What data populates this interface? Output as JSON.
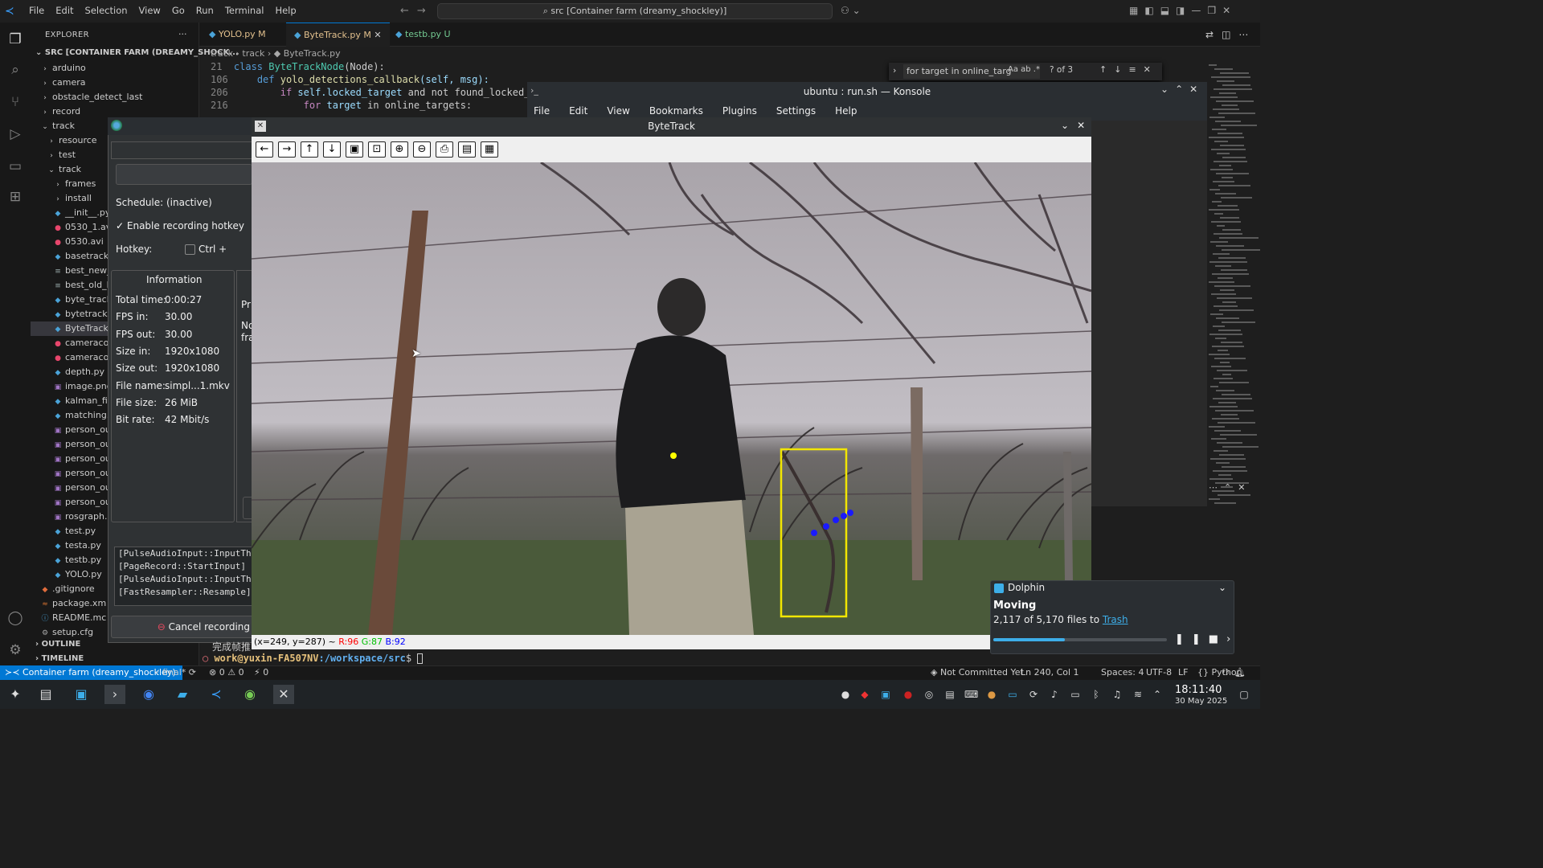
{
  "colors": {
    "accent": "#0078d4",
    "modified": "#e2c08d",
    "trash_link": "#3daee9",
    "tracking_box": "#f2e600",
    "track_points": "#1a1aff",
    "center_point": "#ffff00",
    "status_r": "#ff0000",
    "status_g": "#00c000",
    "status_b": "#0000ff"
  },
  "vscode": {
    "menu": [
      "File",
      "Edit",
      "Selection",
      "View",
      "Go",
      "Run",
      "Terminal",
      "Help"
    ],
    "command_center": "src [Container farm (dreamy_shockley)]",
    "explorer": {
      "title": "EXPLORER",
      "root": "SRC [CONTAINER FARM (DREAMY_SHOCK...",
      "items": [
        {
          "label": "arduino",
          "icon": "chevron-right-icon",
          "fic": "›"
        },
        {
          "label": "camera",
          "icon": "chevron-right-icon",
          "fic": "›"
        },
        {
          "label": "obstacle_detect_last",
          "icon": "chevron-right-icon",
          "fic": "›"
        },
        {
          "label": "record",
          "icon": "chevron-right-icon",
          "fic": "›"
        },
        {
          "label": "track",
          "icon": "chevron-down-icon",
          "fic": "⌄"
        },
        {
          "label": "resource",
          "icon": "chevron-right-icon",
          "fic": "›"
        },
        {
          "label": "test",
          "icon": "chevron-right-icon",
          "fic": "›"
        },
        {
          "label": "track",
          "icon": "chevron-down-icon",
          "fic": "⌄"
        },
        {
          "label": "frames",
          "icon": "chevron-right-icon",
          "fic": "›"
        },
        {
          "label": "install",
          "icon": "chevron-right-icon",
          "fic": "›"
        },
        {
          "label": "__init__.py",
          "icon": "python-file-icon",
          "fic": "◆"
        },
        {
          "label": "0530_1.avi",
          "icon": "video-file-icon",
          "fic": "●"
        },
        {
          "label": "0530.avi",
          "icon": "video-file-icon",
          "fic": "●"
        },
        {
          "label": "basetrack.",
          "icon": "python-file-icon",
          "fic": "◆"
        },
        {
          "label": "best_new_",
          "icon": "text-file-icon",
          "fic": "≡"
        },
        {
          "label": "best_old_l",
          "icon": "text-file-icon",
          "fic": "≡"
        },
        {
          "label": "byte_track",
          "icon": "python-file-icon",
          "fic": "◆"
        },
        {
          "label": "bytetrack.p",
          "icon": "python-file-icon",
          "fic": "◆"
        },
        {
          "label": "ByteTrack.",
          "icon": "python-file-icon",
          "fic": "◆"
        },
        {
          "label": "cameracol",
          "icon": "video-file-icon",
          "fic": "●"
        },
        {
          "label": "cameracol",
          "icon": "video-file-icon",
          "fic": "●"
        },
        {
          "label": "depth.py",
          "icon": "python-file-icon",
          "fic": "◆"
        },
        {
          "label": "image.png",
          "icon": "image-file-icon",
          "fic": "▣"
        },
        {
          "label": "kalman_filt",
          "icon": "python-file-icon",
          "fic": "◆"
        },
        {
          "label": "matching.p",
          "icon": "python-file-icon",
          "fic": "◆"
        },
        {
          "label": "person_ou",
          "icon": "image-file-icon",
          "fic": "▣"
        },
        {
          "label": "person_ou",
          "icon": "image-file-icon",
          "fic": "▣"
        },
        {
          "label": "person_ou",
          "icon": "image-file-icon",
          "fic": "▣"
        },
        {
          "label": "person_ou",
          "icon": "image-file-icon",
          "fic": "▣"
        },
        {
          "label": "person_ou",
          "icon": "image-file-icon",
          "fic": "▣"
        },
        {
          "label": "person_ou",
          "icon": "image-file-icon",
          "fic": "▣"
        },
        {
          "label": "rosgraph.p",
          "icon": "image-file-icon",
          "fic": "▣"
        },
        {
          "label": "test.py",
          "icon": "python-file-icon",
          "fic": "◆"
        },
        {
          "label": "testa.py",
          "icon": "python-file-icon",
          "fic": "◆"
        },
        {
          "label": "testb.py",
          "icon": "python-file-icon",
          "fic": "◆"
        },
        {
          "label": "YOLO.py",
          "icon": "python-file-icon",
          "fic": "◆"
        },
        {
          "label": ".gitignore",
          "icon": "git-icon",
          "fic": "◆"
        },
        {
          "label": "package.xm",
          "icon": "xml-file-icon",
          "fic": "≈"
        },
        {
          "label": "README.mc",
          "icon": "info-icon",
          "fic": "ⓘ"
        },
        {
          "label": "setup.cfg",
          "icon": "gear-icon",
          "fic": "⚙"
        }
      ],
      "outline": "OUTLINE",
      "timeline": "TIMELINE"
    },
    "tabs": [
      {
        "label": "YOLO.py  M"
      },
      {
        "label": "ByteTrack.py  M"
      },
      {
        "label": "testb.py  U"
      }
    ],
    "breadcrumb": "track  ›  track  ›  ◆ ByteTrack.py",
    "code": [
      {
        "num": "21",
        "indent": "",
        "k1": "class ",
        "name": "ByteTrackNode",
        "rest": "(Node):"
      },
      {
        "num": "106",
        "indent": "    ",
        "k1": "def ",
        "name": "yolo_detections_callback",
        "rest": "(self, msg):"
      },
      {
        "num": "206",
        "indent": "        ",
        "k1": "if ",
        "name": "self.locked_target",
        "rest": " and not found_locked_"
      },
      {
        "num": "216",
        "indent": "            ",
        "k1": "for ",
        "name": "target",
        "rest": " in online_targets:"
      }
    ],
    "find": {
      "query": "for target in online_targ",
      "count": "? of 3"
    },
    "terminal": {
      "user": "work@yuxin-FA507NV",
      "path": ":/workspace/src",
      "prompt": "$ "
    },
    "chinese_text": "完成帧推",
    "status": {
      "remote": "Container farm (dreamy_shockley)",
      "branch": "final*",
      "problems": "⊗ 0 ⚠ 0",
      "ports": "⚡ 0",
      "commit": "Not Committed Yet",
      "position": "Ln 240, Col 1",
      "spaces": "Spaces: 4",
      "encoding": "UTF-8",
      "eol": "LF",
      "language": "Python"
    }
  },
  "konsole": {
    "title": "ubuntu : run.sh — Konsole",
    "menu": [
      "File",
      "Edit",
      "View",
      "Bookmarks",
      "Plugins",
      "Settings",
      "Help"
    ]
  },
  "ssr": {
    "schedule": "Schedule: (inactive)",
    "enable_hotkey": "Enable recording hotkey",
    "hotkey_label": "Hotkey:",
    "hotkey_ctrl": "Ctrl +",
    "info_title": "Information",
    "info_rows": [
      {
        "k": "Total time:",
        "v": "0:00:27"
      },
      {
        "k": "FPS in:",
        "v": "30.00"
      },
      {
        "k": "FPS out:",
        "v": "30.00"
      },
      {
        "k": "Size in:",
        "v": "1920x1080"
      },
      {
        "k": "Size out:",
        "v": "1920x1080"
      },
      {
        "k": "File name:",
        "v": "simpl...1.mkv"
      },
      {
        "k": "File size:",
        "v": "26 MiB"
      },
      {
        "k": "Bit rate:",
        "v": "42 Mbit/s"
      }
    ],
    "preview_cut": "Pr",
    "preview_no": "No",
    "preview_fra": "fra",
    "log": [
      "[PulseAudioInput::InputThread",
      "[PageRecord::StartInput] Starte",
      "[PulseAudioInput::InputThread",
      "[FastResampler::Resample] Res"
    ],
    "cancel": "Cancel recording"
  },
  "bytetrack": {
    "title": "ByteTrack",
    "status_coords": "(x=249, y=287) ~ ",
    "status_r": "R:96",
    "status_g": "G:87",
    "status_b": "B:92"
  },
  "dolphin": {
    "app": "Dolphin",
    "title": "Moving",
    "message": "2,117 of 5,170 files to ",
    "link": "Trash",
    "progress": 0.41
  },
  "taskbar": {
    "time": "18:11:40",
    "date": "30 May 2025"
  }
}
